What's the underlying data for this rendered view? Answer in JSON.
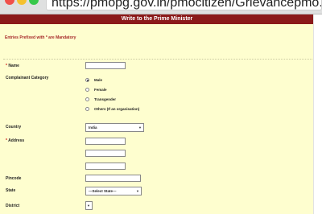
{
  "browser": {
    "url": "https://pmopg.gov.in/pmocitizen/Grievancepmo.aspx"
  },
  "form": {
    "title": "Write to the Prime Minister",
    "mandatory_notice": "Entries Prefixed with * are Mandatory",
    "name_label": "Name",
    "category_label": "Complainant Category",
    "category_options": [
      "Male",
      "Female",
      "Transgender",
      "Others (If an organisation)"
    ],
    "category_selected": "Male",
    "country_label": "Country",
    "country_value": "India",
    "address_label": "Address",
    "pincode_label": "Pincode",
    "state_label": "State",
    "state_value": "---Select State---",
    "district_label": "District"
  }
}
